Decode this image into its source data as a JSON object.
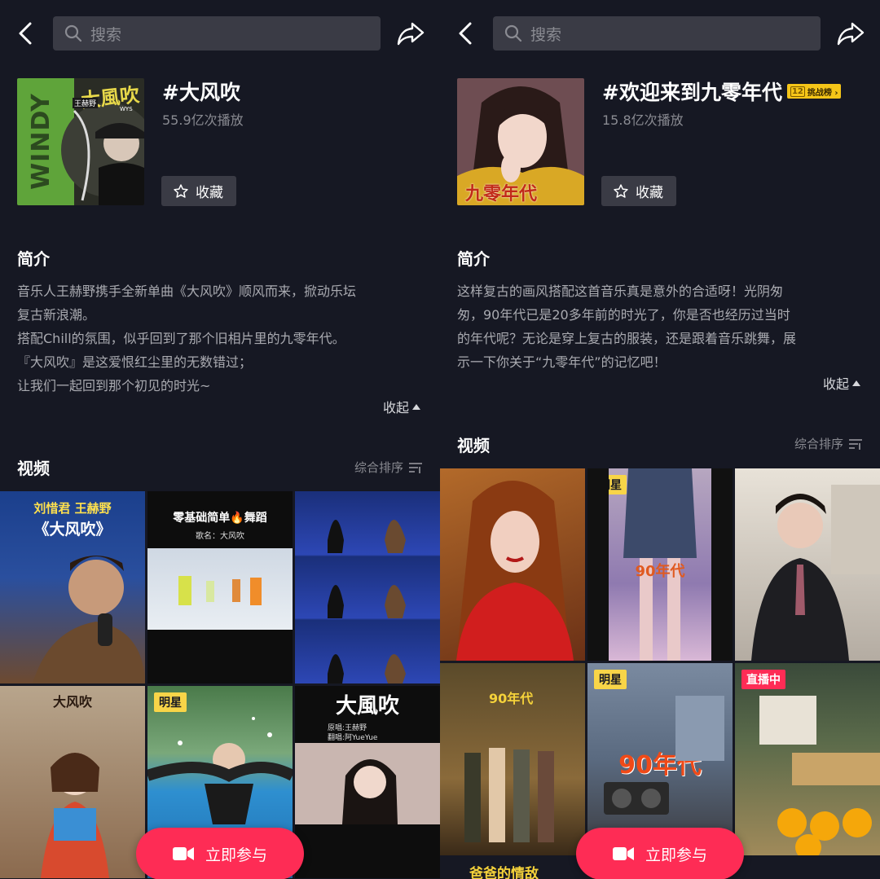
{
  "search": {
    "placeholder": "搜索"
  },
  "left": {
    "title": "#大风吹",
    "play_count": "55.9亿次播放",
    "favorite_label": "收藏",
    "cover_text": {
      "big": "大風吹",
      "side": "WINDY",
      "small": "王赫野",
      "wys": "WYS"
    },
    "intro_title": "简介",
    "intro_lines": [
      "音乐人王赫野携手全新单曲《大风吹》顺风而来，掀动乐坛",
      "复古新浪潮。",
      "搭配Chill的氛围，似乎回到了那个旧相片里的九零年代。",
      "『大风吹』是这爱恨红尘里的无数错过；",
      "让我们一起回到那个初见的时光~"
    ],
    "collapse_label": "收起",
    "videos_title": "视频",
    "sort_label": "综合排序",
    "tiles": [
      {
        "line1": "刘惜君 王赫野",
        "line2": "《大风吹》",
        "tag": ""
      },
      {
        "line1": "零基础简单🔥舞蹈",
        "line2": "歌名：大风吹",
        "tag": ""
      },
      {
        "line1": "",
        "line2": "",
        "tag": ""
      },
      {
        "line1": "大风吹",
        "line2": "",
        "tag": ""
      },
      {
        "line1": "",
        "line2": "",
        "tag": "明星"
      },
      {
        "line1": "大風吹",
        "line2": "原唱:王赫野",
        "line3": "翻唱:阿YueYue",
        "tag": ""
      }
    ],
    "join_label": "立即参与"
  },
  "right": {
    "title": "#欢迎来到九零年代",
    "challenge_badge": {
      "num": "12",
      "text": "挑战榜 ›"
    },
    "play_count": "15.8亿次播放",
    "favorite_label": "收藏",
    "cover_text": "九零年代",
    "intro_title": "简介",
    "intro_lines": [
      "这样复古的画风搭配这首音乐真是意外的合适呀！光阴匆",
      "匆，90年代已是20多年前的时光了，你是否也经历过当时",
      "的年代呢？无论是穿上复古的服装，还是跟着音乐跳舞，展",
      "示一下你关于“九零年代”的记忆吧！"
    ],
    "collapse_label": "收起",
    "videos_title": "视频",
    "sort_label": "综合排序",
    "tiles": [
      {
        "line1": "",
        "tag": ""
      },
      {
        "line1": "90年代",
        "tag": "明星"
      },
      {
        "line1": "",
        "tag": ""
      },
      {
        "line1": "90年代",
        "tag": ""
      },
      {
        "line1": "90年代",
        "tag": "明星"
      },
      {
        "line1": "",
        "tag": "直播中"
      }
    ],
    "bottom_caption": "爸爸的情敌",
    "join_label": "立即参与"
  },
  "colors": {
    "bg": "#161823",
    "accent": "#fe2c55",
    "star_tag": "#f8d548"
  }
}
